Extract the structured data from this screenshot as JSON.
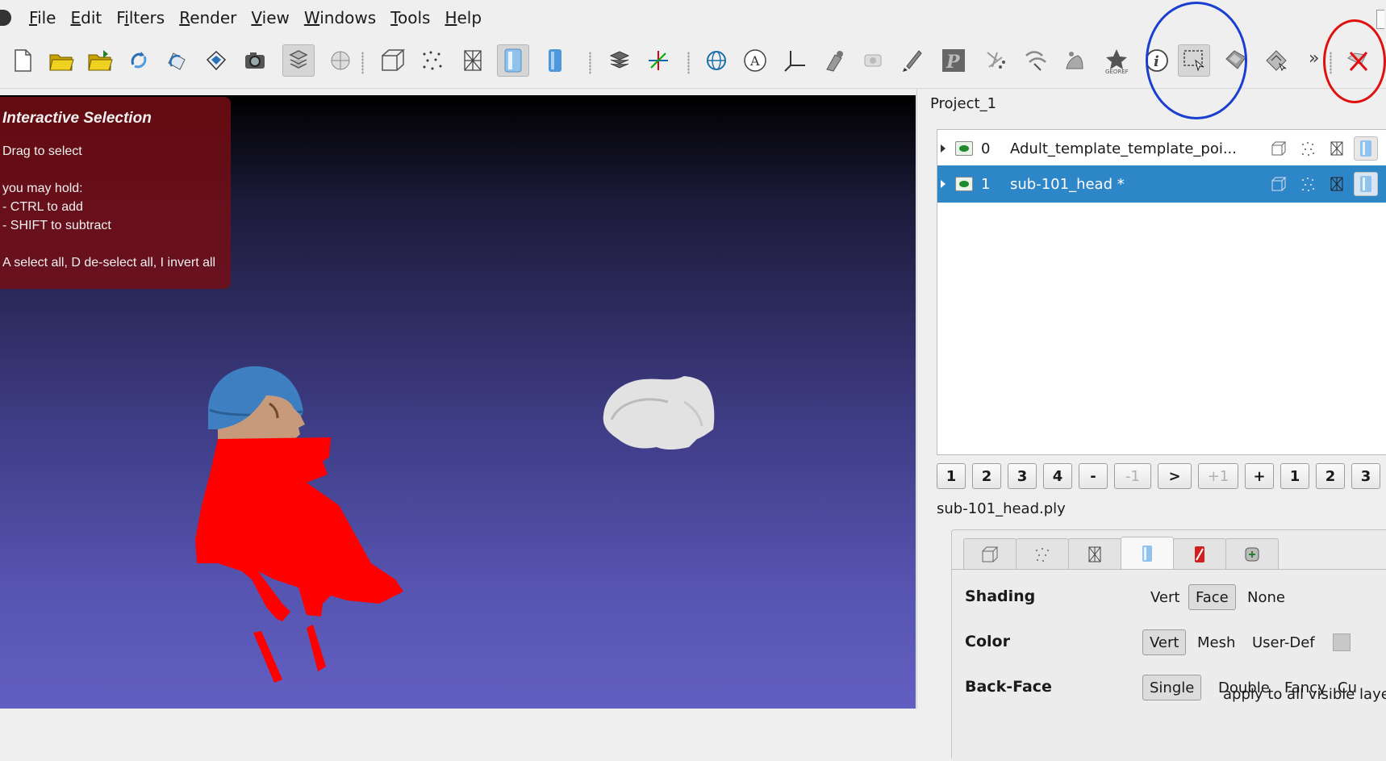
{
  "menu": {
    "items": [
      {
        "label": "File",
        "mnemonic": "F"
      },
      {
        "label": "Edit",
        "mnemonic": "E"
      },
      {
        "label": "Filters",
        "mnemonic": "i"
      },
      {
        "label": "Render",
        "mnemonic": "R"
      },
      {
        "label": "View",
        "mnemonic": "V"
      },
      {
        "label": "Windows",
        "mnemonic": "W"
      },
      {
        "label": "Tools",
        "mnemonic": "T"
      },
      {
        "label": "Help",
        "mnemonic": "H"
      }
    ]
  },
  "toolbar": {
    "overflow_label": "»",
    "icons": [
      "new-project-icon",
      "open-project-icon",
      "import-mesh-icon",
      "reload-icon",
      "reload-all-icon",
      "export-mesh-icon",
      "snapshot-icon",
      "layer-dialog-icon",
      "unknown-sphere-icon",
      "bounding-box-icon",
      "points-icon",
      "wireframe-icon",
      "flat-shading-icon",
      "smooth-shading-icon",
      "layers-icon",
      "axis-icon",
      "trackball-icon",
      "annotation-icon",
      "measure-icon",
      "manipulator-icon",
      "camera-icon",
      "paint-icon",
      "texture-icon",
      "point-picker-icon",
      "align-icon",
      "fractal-icon",
      "georef-icon",
      "info-icon",
      "select-faces-rect-icon",
      "select-connected-icon",
      "select-vertices-icon",
      "delete-selection-icon"
    ]
  },
  "viewport": {
    "panel": {
      "title": "Interactive Selection",
      "line1": "Drag to select",
      "line2": "you may hold:",
      "line3": "- CTRL to add",
      "line4": "- SHIFT to subtract",
      "line5": "A select all, D de-select all, I invert all"
    }
  },
  "project": {
    "title": "Project_1",
    "layers": [
      {
        "index": "0",
        "name": "Adult_template_template_poi...",
        "selected": false
      },
      {
        "index": "1",
        "name": "sub-101_head *",
        "selected": true
      }
    ]
  },
  "layer_nav": {
    "buttons": [
      "1",
      "2",
      "3",
      "4",
      "-",
      "-1",
      ">",
      "+1",
      "+",
      "1",
      "2",
      "3"
    ]
  },
  "file": {
    "name": "sub-101_head.ply"
  },
  "render": {
    "shading": {
      "label": "Shading",
      "options": [
        "Vert",
        "Face",
        "None"
      ],
      "selected": "Face"
    },
    "color": {
      "label": "Color",
      "options": [
        "Vert",
        "Mesh",
        "User-Def"
      ],
      "selected": "Vert"
    },
    "backface": {
      "label": "Back-Face",
      "options": [
        "Single",
        "Double",
        "Fancy",
        "Cu"
      ],
      "selected": "Single"
    },
    "apply_text": "apply to all visible laye"
  },
  "colors": {
    "selection_red": "#ff0000",
    "highlight_blue": "#2d86c8",
    "annotation_blue": "#1a3fd0",
    "annotation_red": "#e01010",
    "panel_red": "#780e14"
  }
}
